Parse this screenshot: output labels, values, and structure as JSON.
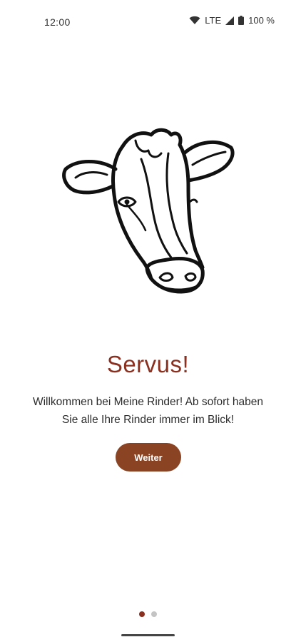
{
  "status_bar": {
    "time": "12:00",
    "network": "LTE",
    "battery": "100 %"
  },
  "onboarding": {
    "illustration": "cow-head-illustration",
    "title": "Servus!",
    "line1": "Willkommen bei Meine Rinder! Ab sofort haben",
    "line2": "Sie alle Ihre Rinder immer im Blick!",
    "button_label": "Weiter",
    "page_current": 1,
    "page_total": 2
  },
  "colors": {
    "accent": "#8b2f1f",
    "button": "#8a4424",
    "dot_inactive": "#c4c4c4"
  }
}
